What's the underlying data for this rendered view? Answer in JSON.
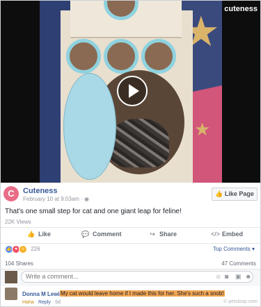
{
  "video": {
    "brand_text": "cuteness",
    "play_label": "Play video"
  },
  "post": {
    "page_name": "Cuteness",
    "page_initial": "C",
    "date": "February 10 at 9:03am",
    "privacy_icon": "globe-icon",
    "like_page_label": "Like Page",
    "text": "That's one small step for cat and one giant leap for feline!",
    "views": "22K Views"
  },
  "actions": {
    "like": "Like",
    "comment": "Comment",
    "share": "Share",
    "embed": "Embed"
  },
  "reactions": {
    "count": "226",
    "top_comments": "Top Comments ▾",
    "shares": "104 Shares",
    "comments": "47 Comments"
  },
  "comment_box": {
    "placeholder": "Write a comment..."
  },
  "comment": {
    "author": "Donna M Lewis",
    "text": "My cat would leave home if I made this for her. She's such a snob!",
    "haha": "Haha",
    "reply": "Reply",
    "time": "5d"
  },
  "watermark": "© petsloop.com",
  "colors": {
    "link": "#365899",
    "brand": "#e96d87",
    "highlight": "#f2a654"
  }
}
